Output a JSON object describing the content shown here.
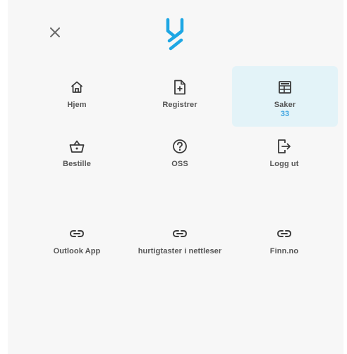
{
  "header": {
    "close_icon": "close-icon",
    "logo_icon": "brand-logo-icon",
    "brand_color": "#1ea7e4"
  },
  "menu": {
    "items": [
      {
        "label": "Hjem",
        "icon": "home-icon"
      },
      {
        "label": "Registrer",
        "icon": "document-add-icon"
      },
      {
        "label": "Saker",
        "icon": "dashboard-icon",
        "count": "33",
        "active": true
      },
      {
        "label": "Bestille",
        "icon": "basket-icon"
      },
      {
        "label": "OSS",
        "icon": "help-circle-icon"
      },
      {
        "label": "Logg ut",
        "icon": "logout-icon"
      }
    ]
  },
  "links": {
    "items": [
      {
        "label": "Outlook App",
        "icon": "link-icon"
      },
      {
        "label": "hurtigtaster i nettleser",
        "icon": "link-icon"
      },
      {
        "label": "Finn.no",
        "icon": "link-icon"
      }
    ]
  },
  "colors": {
    "panel_bg": "#f7f7f7",
    "active_tile_bg": "#e3f3f8",
    "icon_color": "#3a3a3a",
    "count_color": "#3fa4e0"
  }
}
